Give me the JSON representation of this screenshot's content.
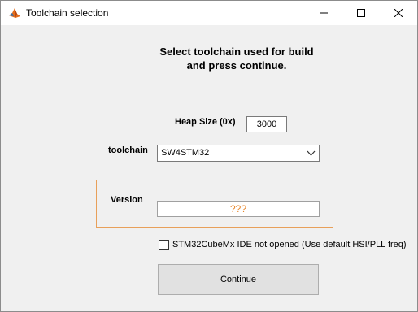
{
  "window": {
    "title": "Toolchain selection",
    "icon": "matlab-icon",
    "controls": [
      "minimize-icon",
      "maximize-icon",
      "close-icon"
    ]
  },
  "dialog": {
    "heading_line1": "Select toolchain used for build",
    "heading_line2": "and press continue.",
    "heap": {
      "label": "Heap Size (0x)",
      "value": "3000"
    },
    "toolchain": {
      "label": "toolchain",
      "selected": "SW4STM32"
    },
    "version": {
      "label": "Version",
      "value": "???",
      "border_color": "#e8a05a",
      "text_color": "#e8862a"
    },
    "cubemx_checkbox": {
      "label": "STM32CubeMx IDE not opened (Use default HSI/PLL freq)",
      "checked": false
    },
    "continue_label": "Continue"
  }
}
